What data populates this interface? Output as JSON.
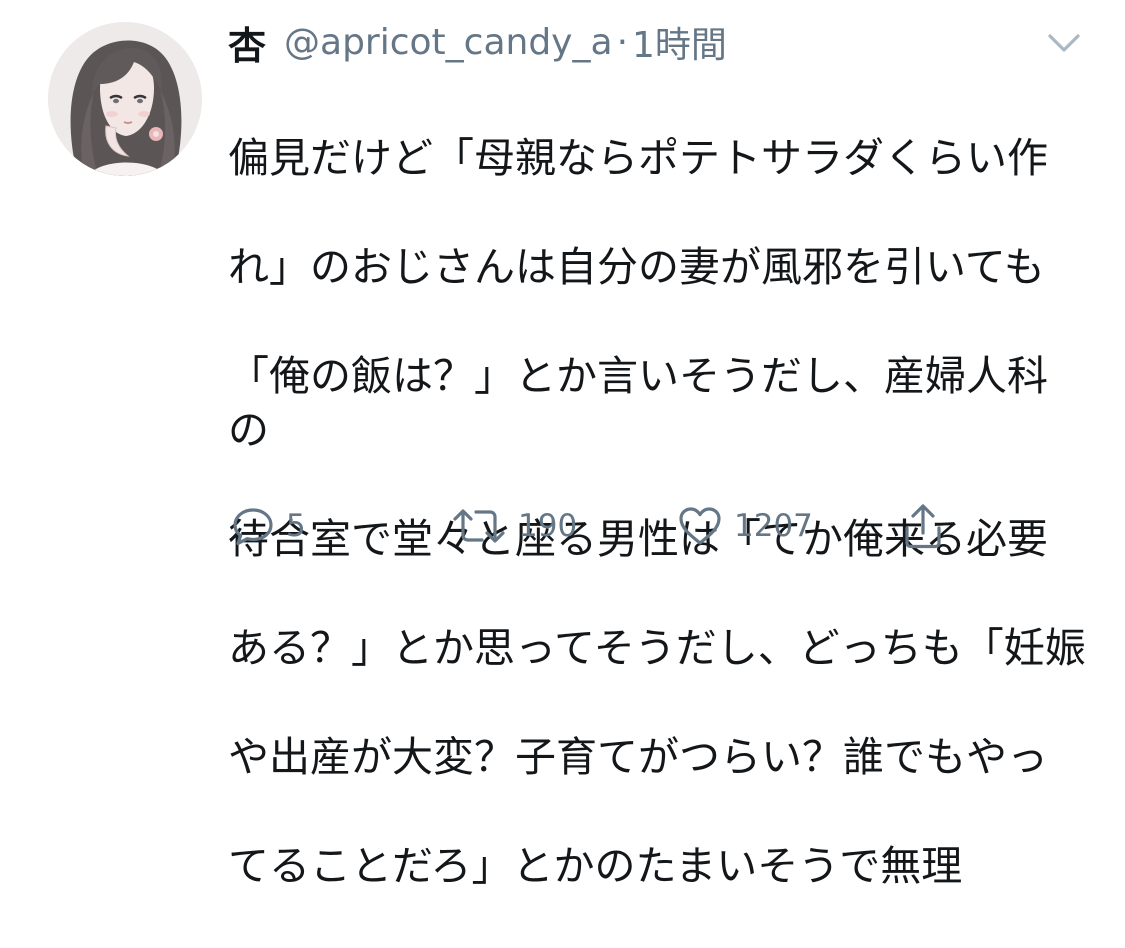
{
  "tweet": {
    "display_name": "杏",
    "handle": "@apricot_candy_a",
    "separator": "·",
    "timestamp": "1時間",
    "text_lines": [
      "偏見だけど「母親ならポテトサラダくらい作",
      "れ」のおじさんは自分の妻が風邪を引いても",
      "「俺の飯は？」とか言いそうだし、産婦人科の",
      "待合室で堂々と座る男性は「てか俺来る必要",
      "ある？」とか思ってそうだし、どっちも「妊娠",
      "や出産が大変？子育てがつらい？誰でもやっ",
      "てることだろ」とかのたまいそうで無理"
    ]
  },
  "actions": {
    "reply": {
      "icon": "reply-icon",
      "count": "5"
    },
    "retweet": {
      "icon": "retweet-icon",
      "count": "190"
    },
    "like": {
      "icon": "heart-icon",
      "count": "1207"
    },
    "share": {
      "icon": "share-icon"
    }
  },
  "colors": {
    "text_primary": "#14171a",
    "text_secondary": "#657786",
    "icon_gray": "#657786",
    "caret_gray": "#aab8c2"
  }
}
